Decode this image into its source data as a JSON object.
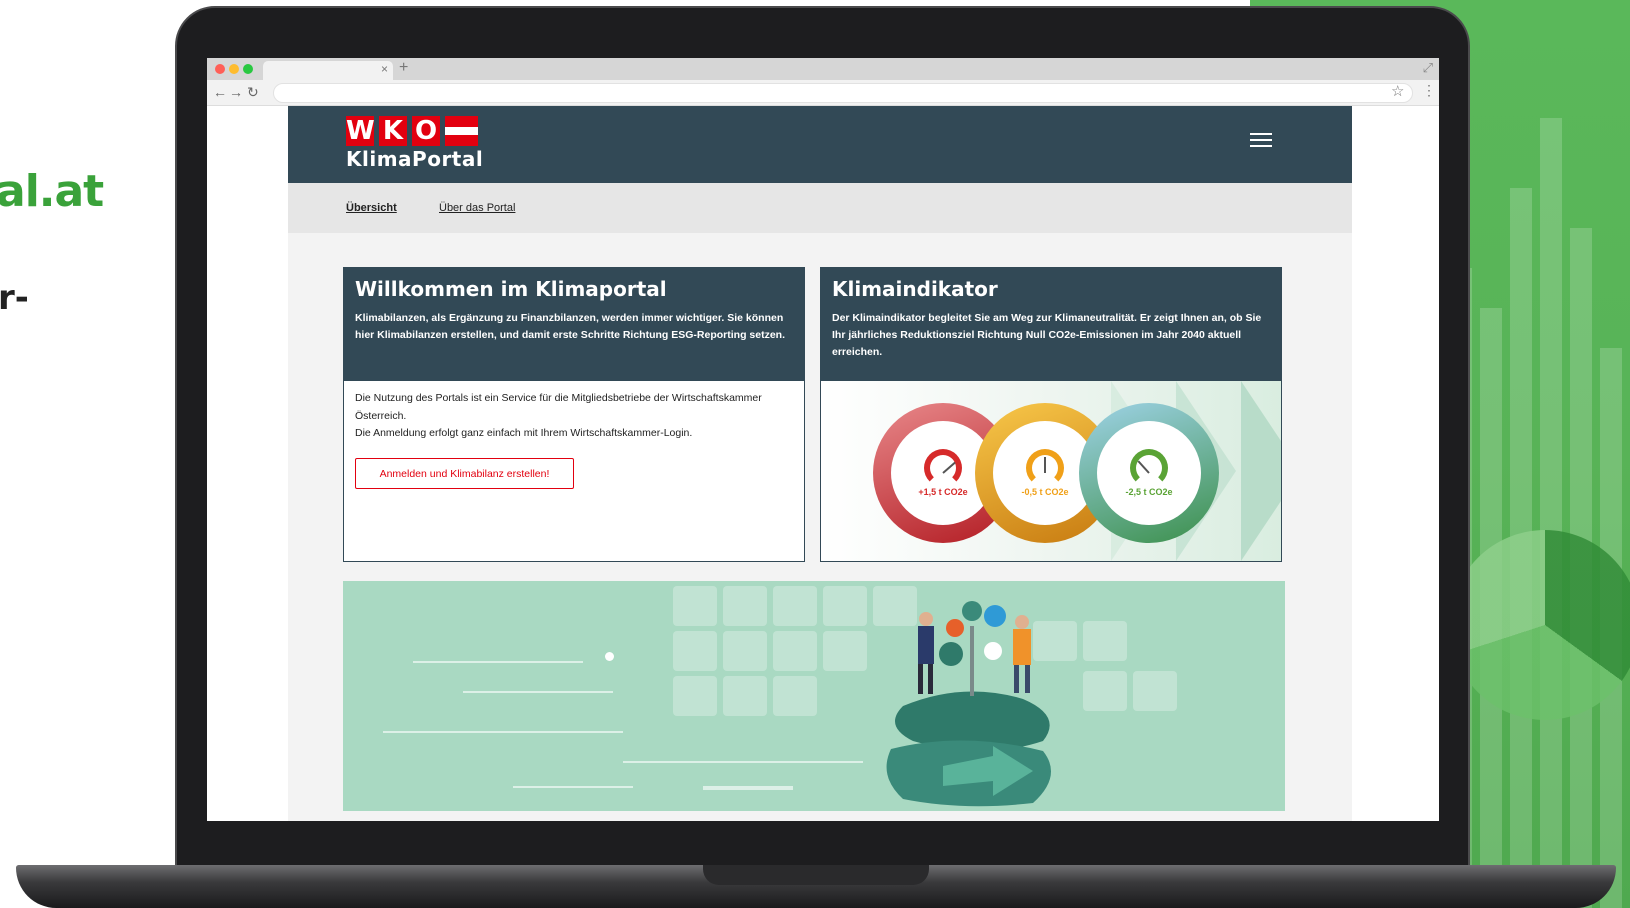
{
  "promo": {
    "domain_fragment": "al.at",
    "dash_fragment": "r-"
  },
  "browser": {
    "tab_close": "×",
    "tab_new": "+"
  },
  "site": {
    "logo": {
      "letters": [
        "W",
        "K",
        "O"
      ],
      "subtitle": "KlimaPortal"
    },
    "nav": {
      "items": [
        "Übersicht",
        "Über das Portal"
      ]
    },
    "welcome_card": {
      "title": "Willkommen im Klimaportal",
      "intro": "Klimabilanzen, als Ergänzung zu Finanzbilanzen, werden immer wichtiger. Sie können hier Klimabilanzen erstellen, und damit erste Schritte Richtung ESG-Reporting setzen.",
      "body_line1": "Die Nutzung des Portals ist ein Service für die Mitgliedsbetriebe der Wirtschaftskammer Österreich.",
      "body_line2": "Die Anmeldung erfolgt ganz einfach mit Ihrem Wirtschaftskammer-Login.",
      "button_label": "Anmelden und Klimabilanz erstellen!"
    },
    "indicator_card": {
      "title": "Klimaindikator",
      "intro": "Der Klimaindikator begleitet Sie am Weg zur Klimaneutralität. Er zeigt Ihnen an, ob Sie Ihr jährliches Reduktionsziel Richtung Null CO2e-Emissionen im Jahr 2040 aktuell erreichen.",
      "gauges": [
        {
          "label": "+1,5 t CO2e",
          "color": "#d62a2a",
          "ring_from": "#e8888a",
          "ring_to": "#b31d24",
          "level": 0.85
        },
        {
          "label": "-0,5 t CO2e",
          "color": "#f0a018",
          "ring_from": "#f8c84a",
          "ring_to": "#c77a10",
          "level": 0.5
        },
        {
          "label": "-2,5 t CO2e",
          "color": "#5aa335",
          "ring_from": "#9fd3e8",
          "ring_to": "#3b8f4a",
          "level": 0.2
        }
      ]
    }
  },
  "colors": {
    "brand_red": "#e2000f",
    "header_navy": "#324956",
    "promo_green": "#3aa23a",
    "banner_mint": "#a9d9c2"
  }
}
